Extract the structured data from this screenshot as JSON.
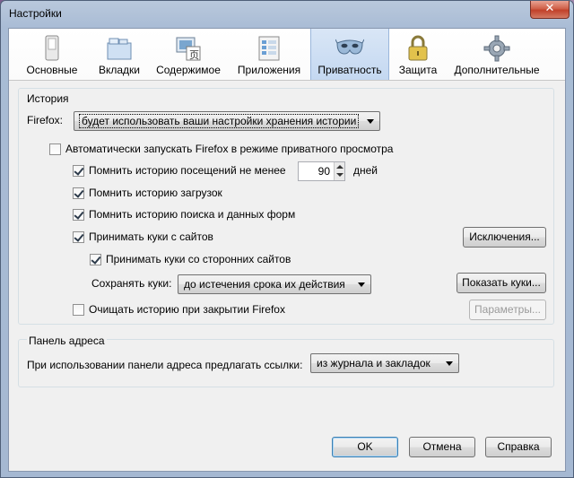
{
  "window": {
    "title": "Настройки",
    "close_glyph": "✕"
  },
  "toolbar": {
    "items": [
      {
        "label": "Основные",
        "icon": "switch-icon"
      },
      {
        "label": "Вкладки",
        "icon": "tabs-icon"
      },
      {
        "label": "Содержимое",
        "icon": "content-icon"
      },
      {
        "label": "Приложения",
        "icon": "applications-icon"
      },
      {
        "label": "Приватность",
        "icon": "mask-icon",
        "active": true
      },
      {
        "label": "Защита",
        "icon": "padlock-icon"
      },
      {
        "label": "Дополнительные",
        "icon": "gear-icon"
      }
    ]
  },
  "history": {
    "title": "История",
    "firefox_label": "Firefox:",
    "mode_value": "будет использовать ваши настройки хранения истории",
    "autostart_private": {
      "label": "Автоматически запускать Firefox в режиме приватного просмотра",
      "checked": false
    },
    "remember_visits": {
      "label": "Помнить историю посещений не менее",
      "checked": true,
      "days_value": "90",
      "days_unit": "дней"
    },
    "remember_downloads": {
      "label": "Помнить историю загрузок",
      "checked": true
    },
    "remember_search": {
      "label": "Помнить историю поиска и данных форм",
      "checked": true
    },
    "accept_cookies": {
      "label": "Принимать куки с сайтов",
      "checked": true
    },
    "exceptions_button": "Исключения...",
    "accept_third_party": {
      "label": "Принимать куки со сторонних сайтов",
      "checked": true
    },
    "keep_cookies_label": "Сохранять куки:",
    "keep_cookies_value": "до истечения срока их действия",
    "show_cookies_button": "Показать куки...",
    "clear_on_close": {
      "label": "Очищать историю при закрытии Firefox",
      "checked": false
    },
    "settings_button": "Параметры..."
  },
  "address_bar": {
    "title": "Панель адреса",
    "suggest_label": "При использовании панели адреса предлагать ссылки:",
    "suggest_value": "из журнала и закладок"
  },
  "footer": {
    "ok": "OK",
    "cancel": "Отмена",
    "help": "Справка"
  }
}
